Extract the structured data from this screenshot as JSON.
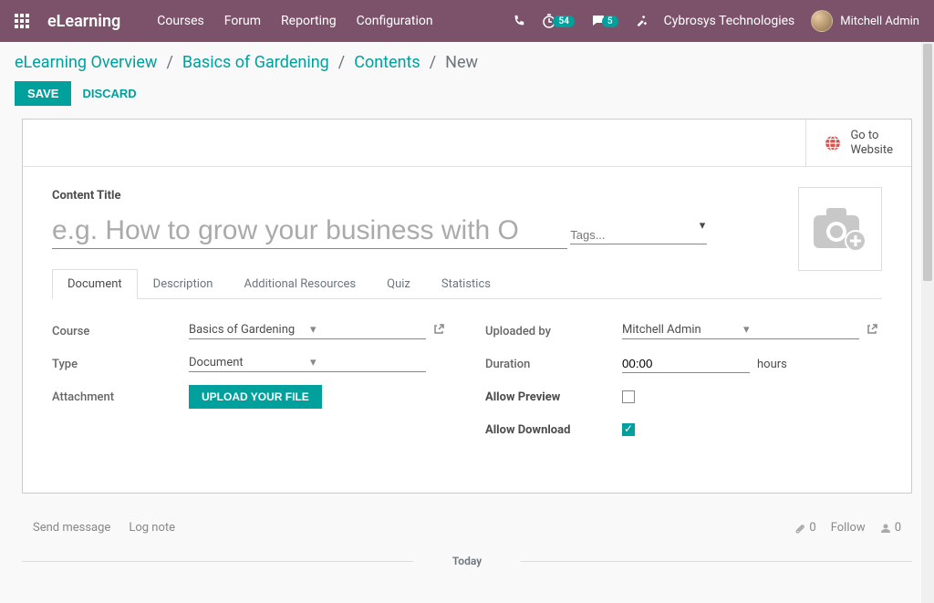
{
  "navbar": {
    "brand": "eLearning",
    "menu": [
      "Courses",
      "Forum",
      "Reporting",
      "Configuration"
    ],
    "timer_badge": "54",
    "chat_badge": "5",
    "company": "Cybrosys Technologies",
    "user": "Mitchell Admin"
  },
  "breadcrumb": {
    "items": [
      "eLearning Overview",
      "Basics of Gardening",
      "Contents"
    ],
    "current": "New"
  },
  "actions": {
    "save": "SAVE",
    "discard": "DISCARD"
  },
  "buttonbar": {
    "goto_website": "Go to",
    "goto_website2": "Website"
  },
  "form": {
    "title_label": "Content Title",
    "title_placeholder": "e.g. How to grow your business with O",
    "tags_placeholder": "Tags..."
  },
  "tabs": [
    "Document",
    "Description",
    "Additional Resources",
    "Quiz",
    "Statistics"
  ],
  "document": {
    "labels": {
      "course": "Course",
      "type": "Type",
      "attachment": "Attachment",
      "uploaded_by": "Uploaded by",
      "duration": "Duration",
      "allow_preview": "Allow Preview",
      "allow_download": "Allow Download"
    },
    "course_value": "Basics of Gardening",
    "type_value": "Document",
    "upload_button": "UPLOAD YOUR FILE",
    "uploaded_by_value": "Mitchell Admin",
    "duration_value": "00:00",
    "duration_unit": "hours",
    "allow_preview": false,
    "allow_download": true
  },
  "chatter": {
    "send": "Send message",
    "log": "Log note",
    "attach_count": "0",
    "follow": "Follow",
    "followers": "0",
    "today": "Today"
  }
}
